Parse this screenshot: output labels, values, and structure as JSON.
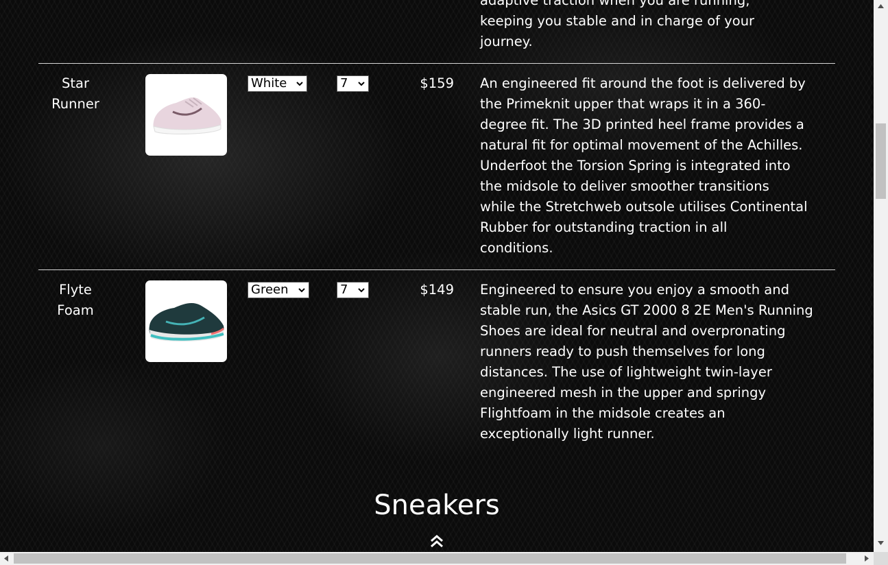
{
  "previous_row": {
    "description_tail": [
      "adaptive traction when you are running,",
      "keeping you stable and in charge of your",
      "journey."
    ]
  },
  "products": [
    {
      "name_lines": [
        "Star",
        "Runner"
      ],
      "color": "White",
      "size": "7",
      "price": "$159",
      "description_lines": [
        "An engineered fit around the foot is delivered by",
        "the Primeknit upper that wraps it in a 360-",
        "degree fit. The 3D printed heel frame provides a",
        "natural fit for optimal movement of the Achilles.",
        "Underfoot the Torsion Spring is integrated into",
        "the midsole to deliver smoother transitions",
        "while the Stretchweb outsole utilises Continental",
        "Rubber for outstanding traction in all",
        "conditions."
      ]
    },
    {
      "name_lines": [
        "Flyte",
        "Foam"
      ],
      "color": "Green",
      "size": "7",
      "price": "$149",
      "description_lines": [
        "Engineered to ensure you enjoy a smooth and",
        "stable run, the Asics GT 2000 8 2E Men's Running",
        "Shoes are ideal for neutral and overpronating",
        "runners ready to push themselves for long",
        "distances. The use of lightweight twin-layer",
        "engineered mesh in the upper and springy",
        "Flightfoam in the midsole creates an",
        "exceptionally light runner."
      ]
    }
  ],
  "section_title": "Sneakers",
  "icons": {
    "back_to_top": "double-chevron-up-icon",
    "select_caret": "chevron-down-icon"
  },
  "colors": {
    "text": "#ffffff",
    "divider": "#d6d6d6",
    "background": "#0b0b0b"
  }
}
